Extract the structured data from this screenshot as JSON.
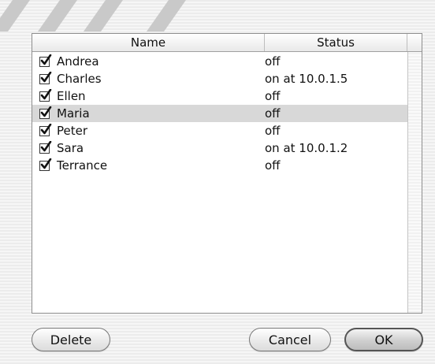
{
  "table": {
    "columns": [
      "Name",
      "Status"
    ],
    "selected_index": 3,
    "rows": [
      {
        "name": "Andrea",
        "status": "off",
        "checked": true
      },
      {
        "name": "Charles",
        "status": "on at 10.0.1.5",
        "checked": true
      },
      {
        "name": "Ellen",
        "status": "off",
        "checked": true
      },
      {
        "name": "Maria",
        "status": "off",
        "checked": true
      },
      {
        "name": "Peter",
        "status": "off",
        "checked": true
      },
      {
        "name": "Sara",
        "status": "on at 10.0.1.2",
        "checked": true
      },
      {
        "name": "Terrance",
        "status": "off",
        "checked": true
      }
    ]
  },
  "buttons": {
    "delete": "Delete",
    "cancel": "Cancel",
    "ok": "OK"
  }
}
